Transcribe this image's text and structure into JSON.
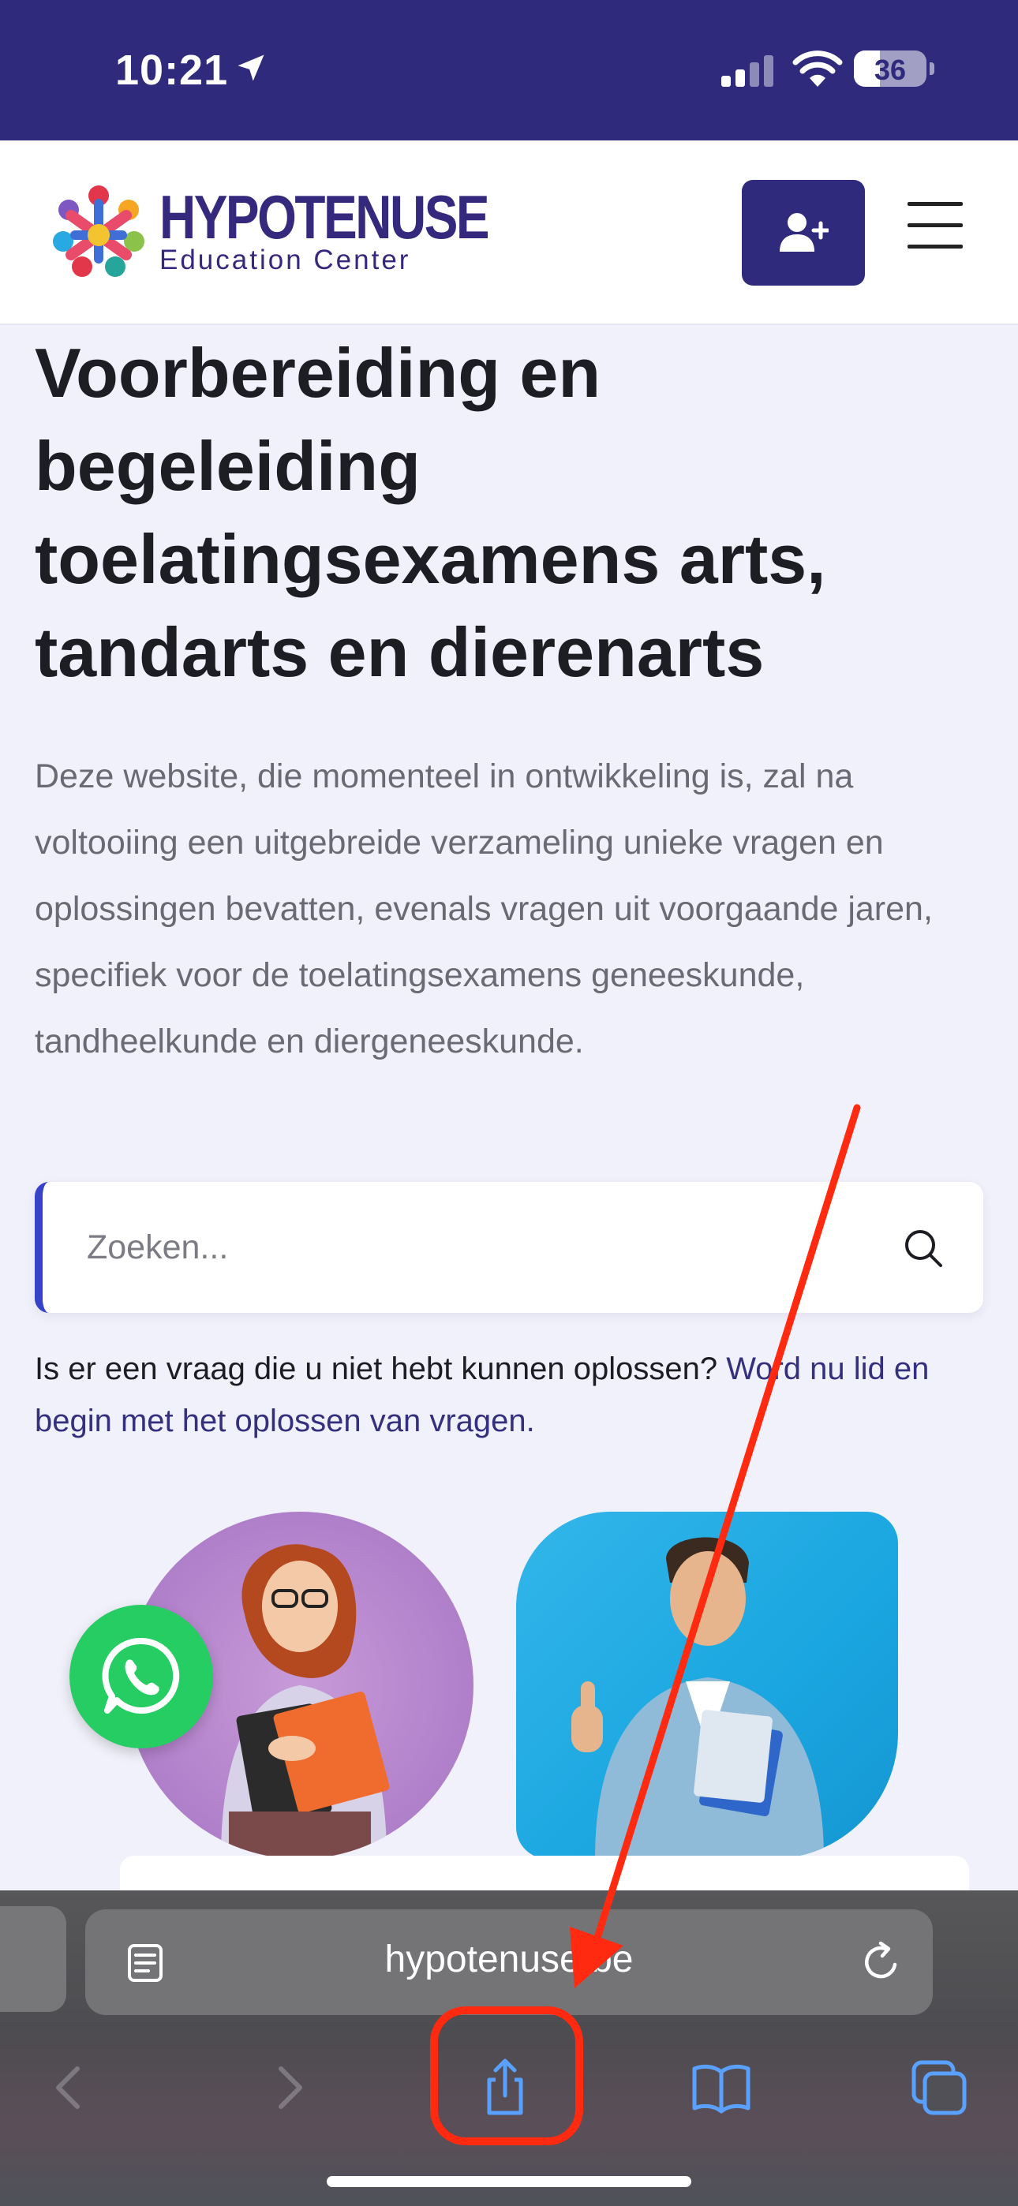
{
  "status_bar": {
    "time": "10:21",
    "battery": "36",
    "icons": [
      "location-arrow-icon",
      "cellular-signal-icon",
      "wifi-icon",
      "battery-icon"
    ]
  },
  "header": {
    "logo_title": "HYPOTENUSE",
    "logo_subtitle": "Education Center",
    "register_icon": "user-plus-icon",
    "menu_icon": "hamburger-menu-icon",
    "brand_color": "#2f2a7c"
  },
  "hero": {
    "title": "Voorbereiding en begeleiding toelatingsexamens arts, tandarts en dierenarts",
    "description": "Deze website, die momenteel in ontwikkeling is, zal na voltooiing een uitgebreide verzameling unieke vragen en oplossingen bevatten, evenals vragen uit voorgaande jaren, specifiek voor de toelatingsexamens geneeskunde, tandheelkunde en diergeneeskunde."
  },
  "search": {
    "placeholder": "Zoeken...",
    "value": "",
    "icon": "search-icon",
    "accent_color": "#3642c8"
  },
  "join": {
    "text": "Is er een vraag die u niet hebt kunnen oplossen?",
    "link": "Word nu lid en begin met het oplossen van vragen."
  },
  "images": {
    "left": "student-girl-image",
    "right": "student-man-image"
  },
  "whatsapp": {
    "icon": "whatsapp-icon",
    "color": "#25cd63"
  },
  "browser": {
    "url": "hypotenuse.be",
    "icons": [
      "reader-icon",
      "reload-icon",
      "back-icon",
      "forward-icon",
      "share-icon",
      "bookmarks-icon",
      "tabs-icon"
    ],
    "accent_color": "#5aa0ff"
  },
  "annotation": {
    "color": "#ff2a10"
  }
}
